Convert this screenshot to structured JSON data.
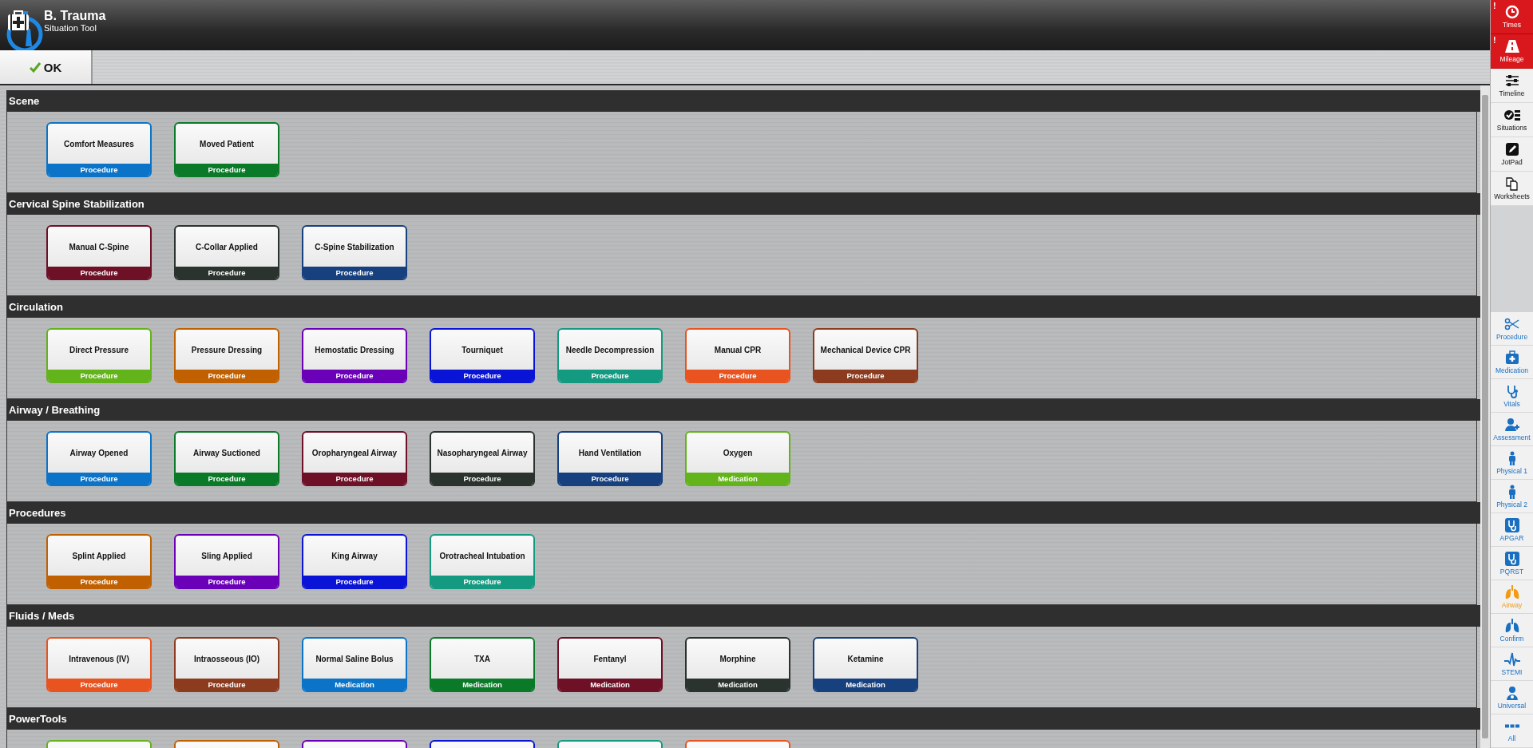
{
  "app": {
    "title": "B. Trauma",
    "subtitle": "Situation Tool"
  },
  "toolbar": {
    "ok_button": "OK"
  },
  "sections": [
    {
      "title": "Scene",
      "cards": [
        {
          "name": "Comfort Measures",
          "type": "Procedure",
          "color": "#0b74c8"
        },
        {
          "name": "Moved Patient",
          "type": "Procedure",
          "color": "#0a7a28"
        }
      ]
    },
    {
      "title": "Cervical Spine Stabilization",
      "cards": [
        {
          "name": "Manual C-Spine",
          "type": "Procedure",
          "color": "#6e1026"
        },
        {
          "name": "C-Collar Applied",
          "type": "Procedure",
          "color": "#2a332e"
        },
        {
          "name": "C-Spine Stabilization",
          "type": "Procedure",
          "color": "#17407e"
        }
      ]
    },
    {
      "title": "Circulation",
      "cards": [
        {
          "name": "Direct Pressure",
          "type": "Procedure",
          "color": "#63b31a"
        },
        {
          "name": "Pressure Dressing",
          "type": "Procedure",
          "color": "#c06000"
        },
        {
          "name": "Hemostatic Dressing",
          "type": "Procedure",
          "color": "#6a00b8"
        },
        {
          "name": "Tourniquet",
          "type": "Procedure",
          "color": "#0a14d6"
        },
        {
          "name": "Needle Decompression",
          "type": "Procedure",
          "color": "#159a82"
        },
        {
          "name": "Manual CPR",
          "type": "Procedure",
          "color": "#e8531f"
        },
        {
          "name": "Mechanical Device CPR",
          "type": "Procedure",
          "color": "#8c3b1f"
        }
      ]
    },
    {
      "title": "Airway / Breathing",
      "cards": [
        {
          "name": "Airway Opened",
          "type": "Procedure",
          "color": "#0b74c8"
        },
        {
          "name": "Airway Suctioned",
          "type": "Procedure",
          "color": "#0a7a28"
        },
        {
          "name": "Oropharyngeal Airway",
          "type": "Procedure",
          "color": "#6e1026"
        },
        {
          "name": "Nasopharyngeal Airway",
          "type": "Procedure",
          "color": "#2a332e"
        },
        {
          "name": "Hand Ventilation",
          "type": "Procedure",
          "color": "#17407e"
        },
        {
          "name": "Oxygen",
          "type": "Medication",
          "color": "#63b31a"
        }
      ]
    },
    {
      "title": "Procedures",
      "cards": [
        {
          "name": "Splint Applied",
          "type": "Procedure",
          "color": "#c06000"
        },
        {
          "name": "Sling Applied",
          "type": "Procedure",
          "color": "#6a00b8"
        },
        {
          "name": "King Airway",
          "type": "Procedure",
          "color": "#0a14d6"
        },
        {
          "name": "Orotracheal Intubation",
          "type": "Procedure",
          "color": "#159a82"
        }
      ]
    },
    {
      "title": "Fluids / Meds",
      "cards": [
        {
          "name": "Intravenous (IV)",
          "type": "Procedure",
          "color": "#e8531f"
        },
        {
          "name": "Intraosseous (IO)",
          "type": "Procedure",
          "color": "#8c3b1f"
        },
        {
          "name": "Normal Saline Bolus",
          "type": "Medication",
          "color": "#0b74c8"
        },
        {
          "name": "TXA",
          "type": "Medication",
          "color": "#0a7a28"
        },
        {
          "name": "Fentanyl",
          "type": "Medication",
          "color": "#6e1026"
        },
        {
          "name": "Morphine",
          "type": "Medication",
          "color": "#2a332e"
        },
        {
          "name": "Ketamine",
          "type": "Medication",
          "color": "#17407e"
        }
      ]
    },
    {
      "title": "PowerTools",
      "cards": [
        {
          "color": "#63b31a"
        },
        {
          "color": "#c06000"
        },
        {
          "color": "#6a00b8"
        },
        {
          "color": "#0a14d6"
        },
        {
          "color": "#159a82"
        },
        {
          "color": "#e8531f"
        }
      ]
    }
  ],
  "sidebar": {
    "top_items": [
      {
        "label": "Times",
        "alert": true,
        "badge": "!"
      },
      {
        "label": "Mileage",
        "alert": true,
        "badge": "!"
      },
      {
        "label": "Timeline",
        "alert": false
      },
      {
        "label": "Situations",
        "alert": false
      },
      {
        "label": "JotPad",
        "alert": false
      },
      {
        "label": "Worksheets",
        "alert": false
      }
    ],
    "bottom_items": [
      {
        "label": "Procedure",
        "selected": false
      },
      {
        "label": "Medication",
        "selected": false
      },
      {
        "label": "Vitals",
        "selected": false
      },
      {
        "label": "Assessment",
        "selected": false
      },
      {
        "label": "Physical 1",
        "selected": false
      },
      {
        "label": "Physical 2",
        "selected": false
      },
      {
        "label": "APGAR",
        "selected": false
      },
      {
        "label": "PQRST",
        "selected": false
      },
      {
        "label": "Airway",
        "selected": true
      },
      {
        "label": "Confirm",
        "selected": false
      },
      {
        "label": "STEMI",
        "selected": false
      },
      {
        "label": "Universal",
        "selected": false
      },
      {
        "label": "All",
        "selected": false
      }
    ]
  }
}
